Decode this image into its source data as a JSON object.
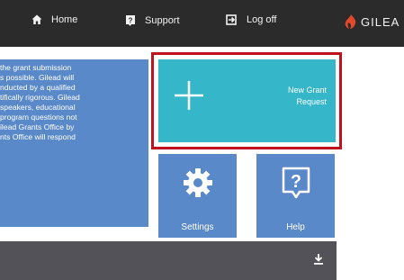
{
  "topbar": {
    "home_label": "Home",
    "support_label": "Support",
    "logoff_label": "Log off",
    "logo_text": "GILEA"
  },
  "info_panel": {
    "lines": [
      "the grant submission",
      "s possible. Gilead will",
      "nducted by a qualified",
      "tifically rigorous. Gilead",
      "speakers, educational",
      "program questions not",
      "ilead Grants Office by",
      "nts Office will respond"
    ]
  },
  "tiles": {
    "new_grant_line1": "New Grant",
    "new_grant_line2": "Request",
    "settings_label": "Settings",
    "help_label": "Help"
  },
  "icons": {
    "home": "home-icon",
    "support": "help-badge-icon",
    "logoff": "logout-icon",
    "plus": "plus-icon",
    "settings": "gear-icon",
    "help": "question-mark-icon",
    "download": "download-icon"
  },
  "colors": {
    "topbar": "#2b2b2b",
    "panel_blue": "#5a89c9",
    "new_grant_teal": "#35b7c9",
    "highlight_red": "#c0121d",
    "bottom_bar": "#525258"
  }
}
